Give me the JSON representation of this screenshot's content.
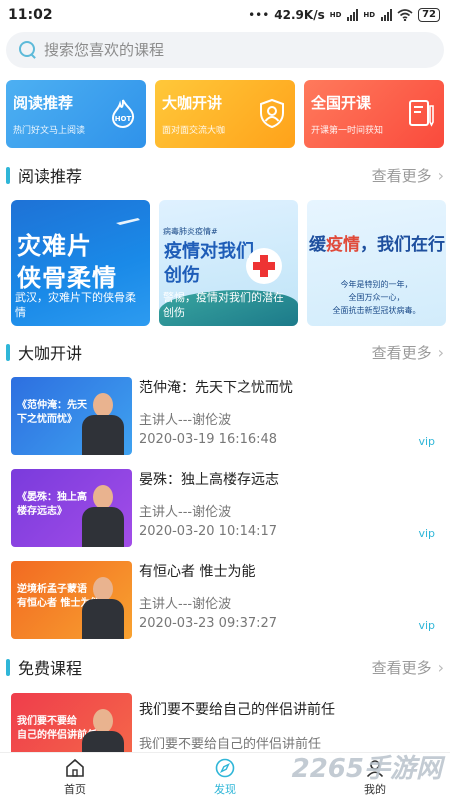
{
  "status_bar": {
    "time": "11:02",
    "net_speed": "42.9K/s",
    "battery": "72"
  },
  "search": {
    "placeholder": "搜索您喜欢的课程"
  },
  "categories": [
    {
      "title": "阅读推荐",
      "subtitle": "热门好文马上阅读",
      "badge": "HOT",
      "icon": "fire-icon"
    },
    {
      "title": "大咖开讲",
      "subtitle": "面对面交流大咖",
      "icon": "user-shield-icon"
    },
    {
      "title": "全国开课",
      "subtitle": "开课第一时间获知",
      "icon": "book-pen-icon"
    }
  ],
  "reading": {
    "title": "阅读推荐",
    "more": "查看更多",
    "items": [
      {
        "headline_1": "灾难片",
        "headline_2": "侠骨柔情",
        "caption": "武汉，灾难片下的侠骨柔情"
      },
      {
        "tag": "病毒肺炎疫情#",
        "headline_1": "疫情对我们",
        "headline_2": "创伤",
        "caption": "警惕，疫情对我们的潜在创伤"
      },
      {
        "headline_lead": "缓",
        "headline_acc": "疫情",
        "headline_rest": "，我们在行",
        "line_1": "今年是特别的一年，",
        "line_2": "全国万众一心，",
        "line_3": "全面抗击新型冠状病毒。"
      }
    ]
  },
  "lectures": {
    "title": "大咖开讲",
    "more": "查看更多",
    "items": [
      {
        "thumb_text_1": "《范仲淹：先天",
        "thumb_text_2": "下之忧而忧》",
        "title": "范仲淹：先天下之忧而忧",
        "speaker": "主讲人---谢伦波",
        "date": "2020-03-19 16:16:48",
        "badge": "vip"
      },
      {
        "thumb_text_1": "《晏殊：独上高",
        "thumb_text_2": "楼存远志》",
        "title": "晏殊：独上高楼存远志",
        "speaker": "主讲人---谢伦波",
        "date": "2020-03-20 10:14:17",
        "badge": "vip"
      },
      {
        "thumb_text_1": "逆境析孟子蒙语",
        "thumb_text_2": "有恒心者 惟士为能",
        "title": "有恒心者 惟士为能",
        "speaker": "主讲人---谢伦波",
        "date": "2020-03-23 09:37:27",
        "badge": "vip"
      }
    ]
  },
  "free": {
    "title": "免费课程",
    "more": "查看更多",
    "items": [
      {
        "thumb_text_1": "我们要不要给",
        "thumb_text_2": "自己的伴侣讲前任",
        "title": "我们要不要给自己的伴侣讲前任",
        "subtitle": "我们要不要给自己的伴侣讲前任"
      }
    ]
  },
  "tabbar": [
    {
      "label": "首页",
      "icon": "home-icon"
    },
    {
      "label": "发现",
      "icon": "compass-icon",
      "active": true
    },
    {
      "label": "我的",
      "icon": "profile-icon"
    }
  ],
  "watermark": "2265手游网",
  "colors": {
    "accent": "#2fb6d8",
    "card_blue": "#3aa0ee",
    "card_orange": "#ffb22a",
    "card_red": "#fb5a45"
  }
}
